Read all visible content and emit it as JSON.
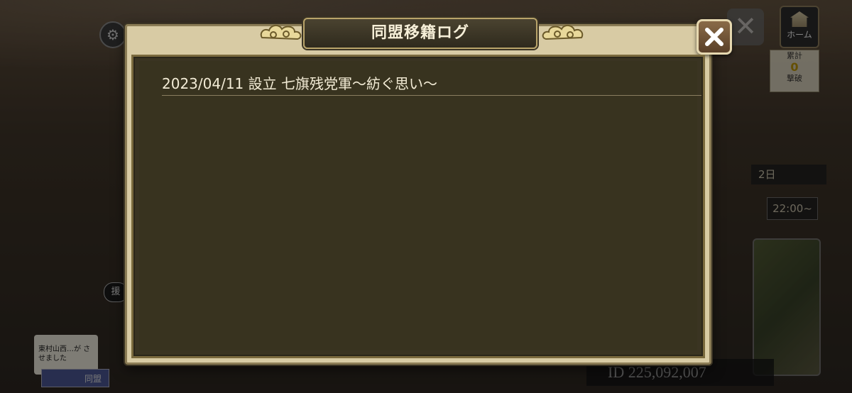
{
  "dialog": {
    "title": "同盟移籍ログ",
    "log_entries": [
      {
        "text": "2023/04/11 設立 七旗残党軍～紡ぐ思い～"
      }
    ],
    "close_icon": "close-x-icon"
  },
  "background": {
    "home_label": "ホーム",
    "tally_top": "累計",
    "tally_value": "0",
    "tally_bottom": "撃破",
    "days_label": "2日",
    "time_label": "22:00~",
    "player_id": "ID 225,092,007",
    "chat_note": "東村山西…が させました",
    "alliance_button": "同盟",
    "side_pill": "援"
  },
  "colors": {
    "frame": "#d8cba4",
    "panel": "#38331f",
    "text": "#f3ecd6",
    "accent": "#b9a46a"
  }
}
